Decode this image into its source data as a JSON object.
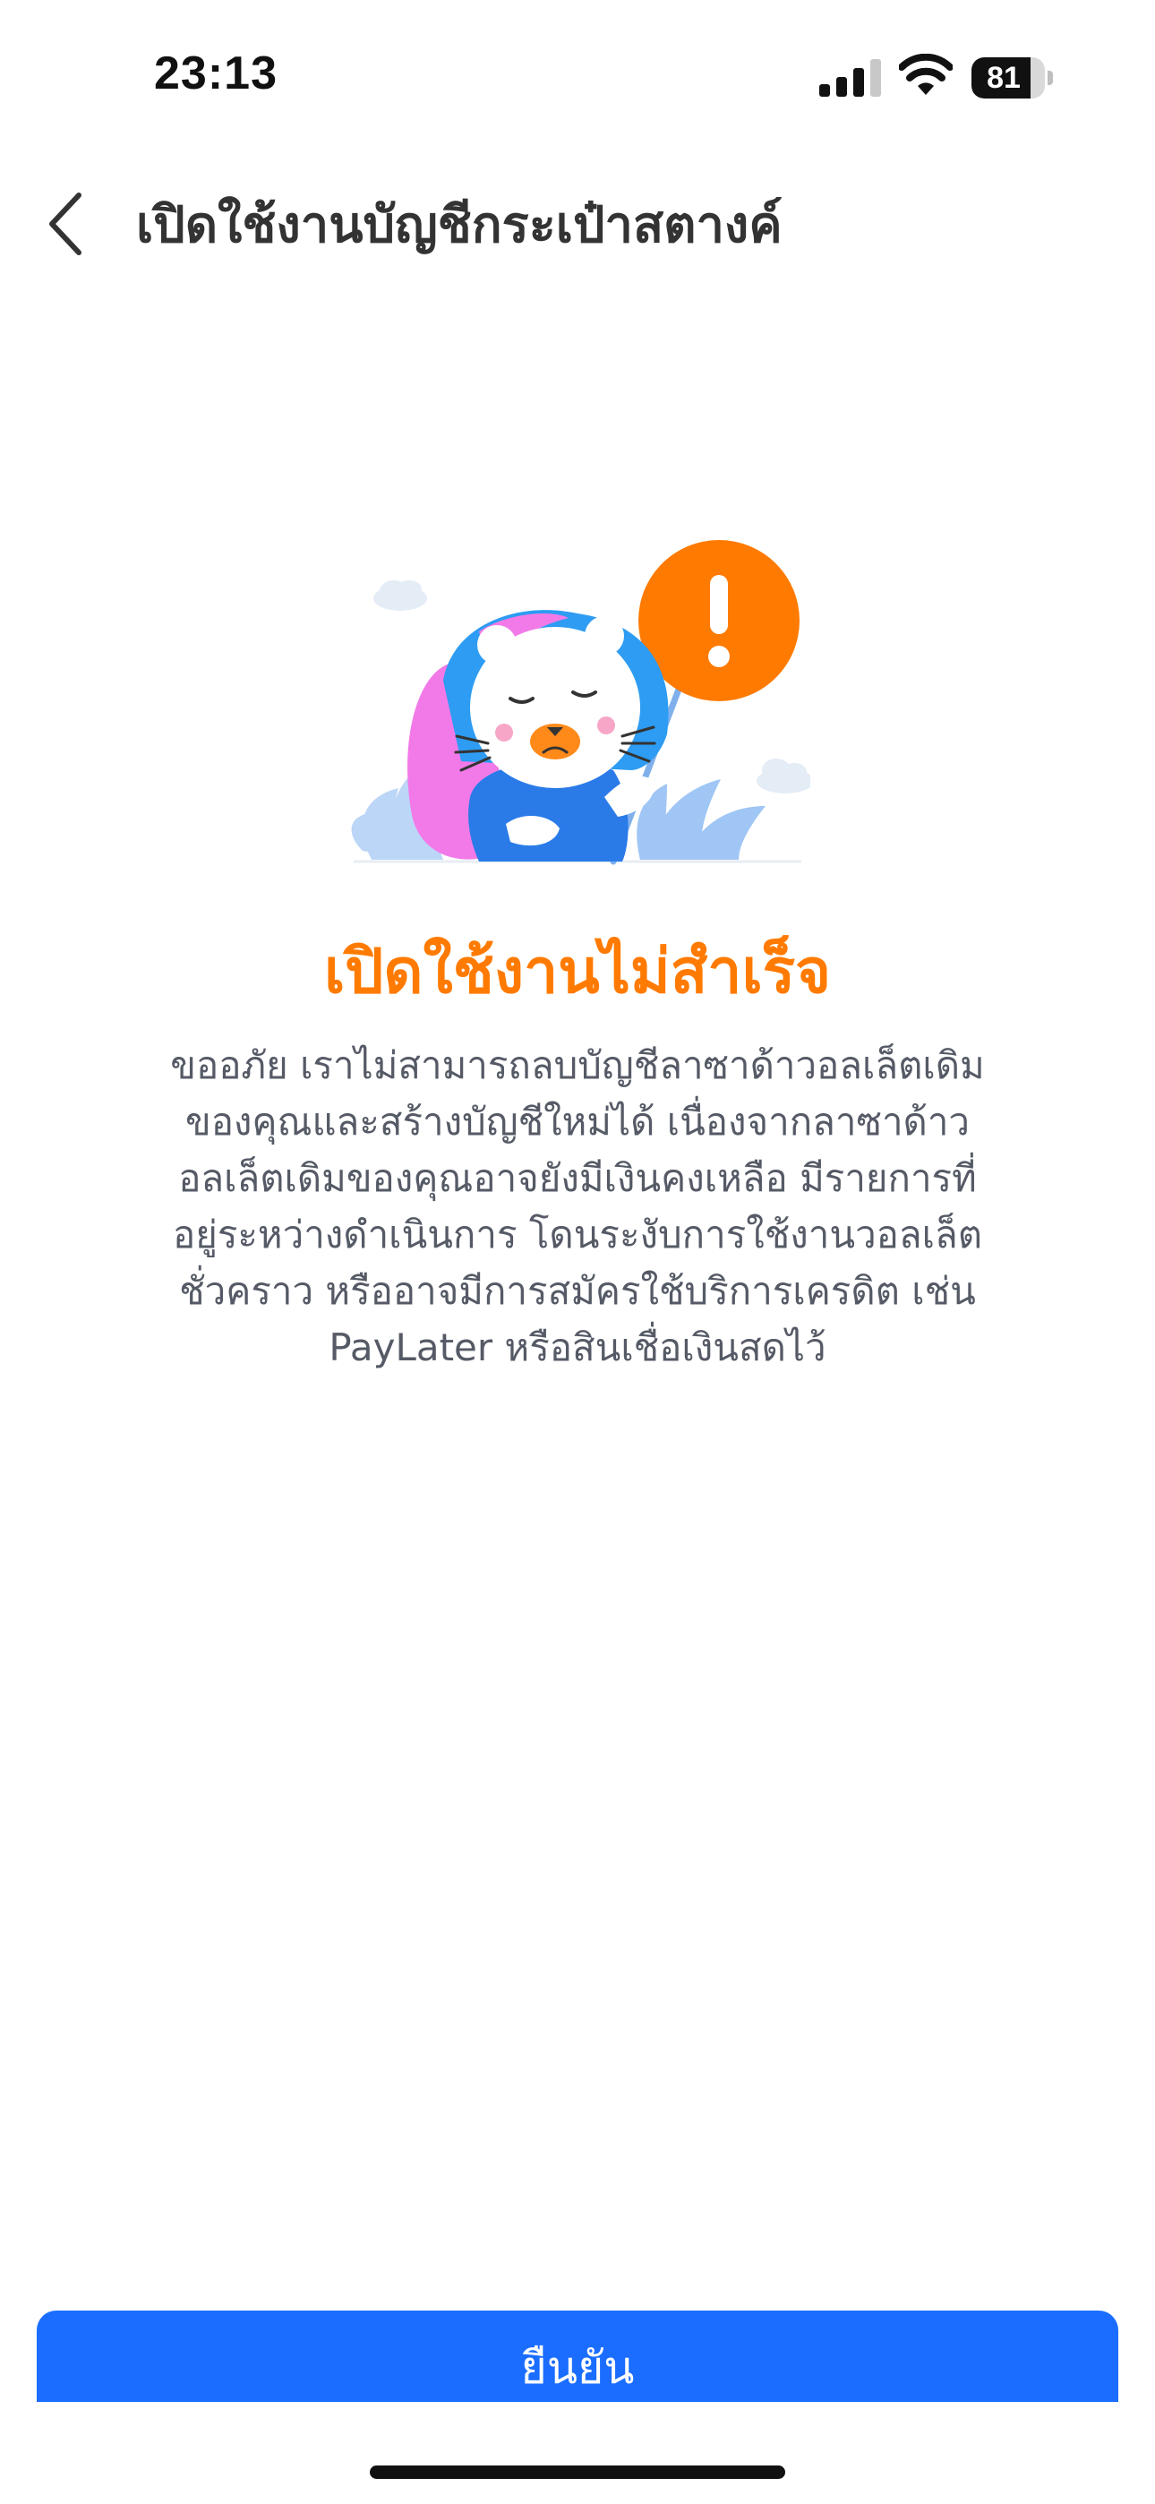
{
  "status_bar": {
    "time": "23:13",
    "battery_level": "81",
    "battery_fraction": 0.81,
    "icons": [
      "signal-icon",
      "wifi-icon",
      "battery-icon"
    ]
  },
  "header": {
    "back_icon": "chevron-left-icon",
    "title": "เปิดใช้งานบัญชีกระเป๋าสตางค์"
  },
  "illustration": {
    "icon": "sad-cat-warning-illustration",
    "alert_icon": "exclamation-icon"
  },
  "result": {
    "title": "เปิดใช้งานไม่สำเร็จ",
    "description_lines": [
      "ขออภัย เราไม่สามารถลบบัญชีลาซาด้าวอลเล็ตเดิม",
      "ของคุณและสร้างบัญชีใหม่ได้ เนื่องจากลาซาด้าว",
      "อลเล็ตเดิมของคุณอาจยังมีเงินคงเหลือ มีรายการที่",
      "อยู่ระหว่างดำเนินการ โดนระงับการใช้งานวอลเล็ต",
      "ชั่วคราว หรืออาจมีการสมัครใช้บริการเครดิต เช่น",
      "PayLater หรือสินเชื่อเงินสดไว้"
    ]
  },
  "footer": {
    "confirm_label": "ยืนยัน"
  },
  "colors": {
    "accent_orange": "#ff7a00",
    "primary_blue": "#1a6dff",
    "title_text": "#333333",
    "body_text": "#555a66"
  }
}
